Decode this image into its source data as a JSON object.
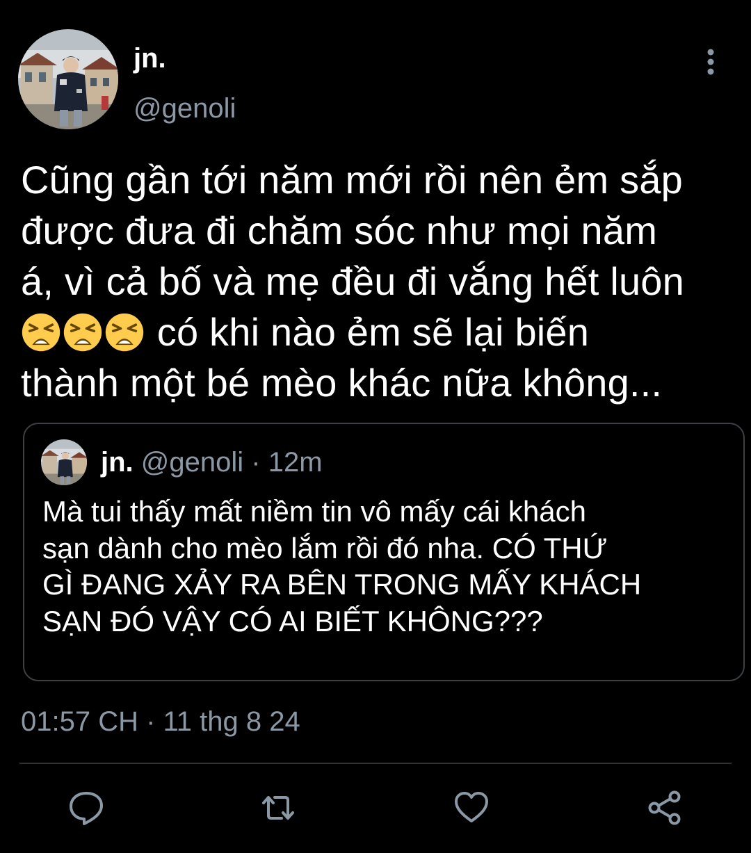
{
  "author": {
    "display_name": "jn.",
    "handle": "@genoli"
  },
  "tweet": {
    "lines": [
      "Cũng gần tới năm mới rồi nên ẻm sắp",
      "được đưa đi chăm sóc như mọi năm",
      "á, vì cả bố và mẹ đều đi vắng hết luôn",
      " có khi nào ẻm sẽ lại biến",
      "thành một bé mèo khác nữa không..."
    ],
    "emoji": [
      "tired-face-emoji",
      "tired-face-emoji",
      "tired-face-emoji"
    ],
    "timestamp": "01:57 CH · 11 thg 8 24"
  },
  "quoted_tweet": {
    "display_name": "jn.",
    "meta": "@genoli · 12m",
    "lines": [
      "Mà tui thấy mất niềm tin vô mấy cái khách",
      "sạn dành cho mèo lắm rồi đó nha. CÓ THỨ",
      "GÌ ĐANG XẢY RA BÊN TRONG MẤY KHÁCH",
      "SẠN ĐÓ VẬY CÓ AI BIẾT KHÔNG???"
    ]
  },
  "actions": {
    "reply": "reply-icon",
    "retweet": "retweet-icon",
    "like": "heart-icon",
    "share": "share-icon"
  },
  "colors": {
    "background": "#000000",
    "text": "#ffffff",
    "secondary": "#8b98a5",
    "border": "#3e4144",
    "icon": "#8b98a5"
  }
}
